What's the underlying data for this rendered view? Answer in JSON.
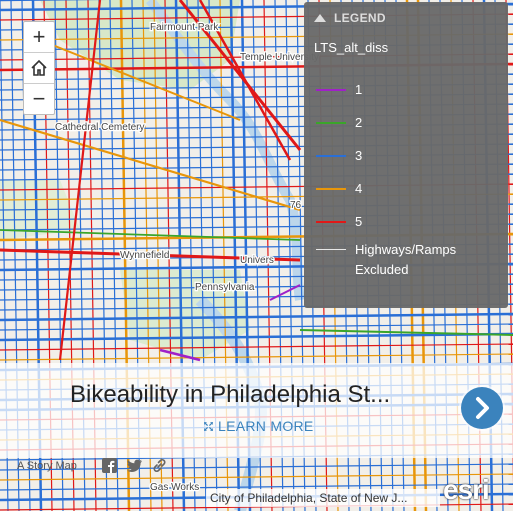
{
  "map": {
    "labels": [
      "Fairmount Park",
      "Cathedral Cemetery",
      "Temple University",
      "Wynnefield",
      "Univers",
      "Pennsylvania",
      "Gas Works",
      "76"
    ]
  },
  "zoom": {
    "in": "+",
    "home_icon": "home-icon",
    "out": "−"
  },
  "legend": {
    "header": "LEGEND",
    "layer": "LTS_alt_diss",
    "items": [
      {
        "label": "1",
        "color": "#a020c8"
      },
      {
        "label": "2",
        "color": "#3aa52a"
      },
      {
        "label": "3",
        "color": "#2a6fd6"
      },
      {
        "label": "4",
        "color": "#e8960a"
      },
      {
        "label": "5",
        "color": "#e01818"
      },
      {
        "label": "Highways/Ramps Excluded",
        "color": "#e8e8e8"
      }
    ]
  },
  "banner": {
    "title": "Bikeability in Philadelphia St...",
    "learn_more": "LEARN MORE",
    "story_map": "A Story Map"
  },
  "attribution": "City of Philadelphia, State of New J...",
  "esri": "esri",
  "colors": {
    "accent": "#3b83bd"
  }
}
